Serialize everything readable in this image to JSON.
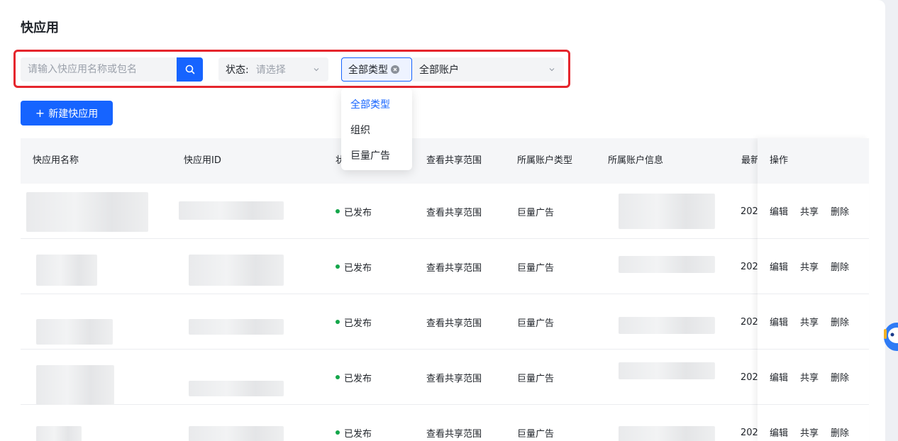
{
  "page": {
    "title": "快应用"
  },
  "filters": {
    "search_placeholder": "请输入快应用名称或包名",
    "status_label": "状态:",
    "status_placeholder": "请选择",
    "type_selected": "全部类型",
    "account_selected": "全部账户"
  },
  "type_dropdown": {
    "options": [
      "全部类型",
      "组织",
      "巨量广告"
    ],
    "active_index": 0
  },
  "toolbar": {
    "new_button_plus": "+",
    "new_button_label": "新建快应用"
  },
  "table": {
    "columns": [
      "快应用名称",
      "快应用ID",
      "状",
      "查看共享范围",
      "所属账户类型",
      "所属账户信息",
      "最新",
      "操作"
    ],
    "rows": [
      {
        "status": "已发布",
        "share": "查看共享范围",
        "account_type": "巨量广告",
        "date": "202",
        "actions": [
          "编辑",
          "共享",
          "删除"
        ]
      },
      {
        "status": "已发布",
        "share": "查看共享范围",
        "account_type": "巨量广告",
        "date": "202",
        "actions": [
          "编辑",
          "共享",
          "删除"
        ]
      },
      {
        "status": "已发布",
        "share": "查看共享范围",
        "account_type": "巨量广告",
        "date": "202",
        "actions": [
          "编辑",
          "共享",
          "删除"
        ]
      },
      {
        "status": "已发布",
        "share": "查看共享范围",
        "account_type": "巨量广告",
        "date": "202",
        "actions": [
          "编辑",
          "共享",
          "删除"
        ]
      },
      {
        "status": "已发布",
        "share": "查看共享范围",
        "account_type": "巨量广告",
        "date": "202",
        "actions": [
          "编辑",
          "共享",
          "删除"
        ]
      }
    ]
  },
  "colors": {
    "primary": "#1664ff",
    "published": "#14a64a",
    "highlight_border": "#e5262d"
  },
  "icons": {
    "search": "search-icon",
    "select_arrow": "chevron-down-icon",
    "clear": "clear-icon",
    "assistant": "assistant-robot-icon"
  }
}
